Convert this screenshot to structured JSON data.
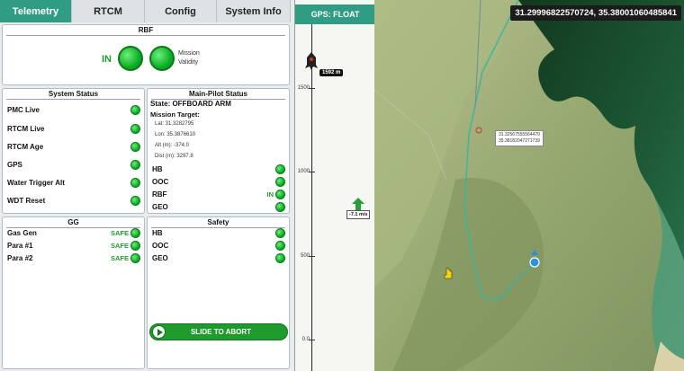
{
  "tabs": [
    {
      "label": "Telemetry",
      "active": true
    },
    {
      "label": "RTCM",
      "active": false
    },
    {
      "label": "Config",
      "active": false
    },
    {
      "label": "System Info",
      "active": false
    }
  ],
  "rbf": {
    "title": "RBF",
    "in_label": "IN",
    "mission_label_1": "Mission",
    "mission_label_2": "Validity"
  },
  "system_status": {
    "title": "System Status",
    "items": [
      {
        "label": "PMC Live",
        "state": ""
      },
      {
        "label": "RTCM Live",
        "state": ""
      },
      {
        "label": "RTCM Age",
        "state": ""
      },
      {
        "label": "GPS",
        "state": ""
      },
      {
        "label": "Water Trigger Alt",
        "state": ""
      },
      {
        "label": "WDT Reset",
        "state": ""
      }
    ]
  },
  "main_pilot": {
    "title": "Main-Pilot Status",
    "state": "State: OFFBOARD ARM",
    "mission_target": "Mission Target:",
    "lat": "Lat: 31.3282795",
    "lon": "Lon: 35.3876610",
    "alt": "Alt (m): -374.0",
    "dist": "Dist (m): 3297.8",
    "items": [
      {
        "label": "HB",
        "state": ""
      },
      {
        "label": "OOC",
        "state": ""
      },
      {
        "label": "RBF",
        "state": "IN"
      },
      {
        "label": "GEO",
        "state": ""
      }
    ]
  },
  "gg": {
    "title": "GG",
    "items": [
      {
        "label": "Gas Gen",
        "state": "SAFE"
      },
      {
        "label": "Para #1",
        "state": "SAFE"
      },
      {
        "label": "Para #2",
        "state": "SAFE"
      }
    ]
  },
  "safety": {
    "title": "Safety",
    "items": [
      {
        "label": "HB",
        "state": ""
      },
      {
        "label": "OOC",
        "state": ""
      },
      {
        "label": "GEO",
        "state": ""
      }
    ]
  },
  "abort": {
    "label": "SLIDE TO ABORT"
  },
  "altitude": {
    "gps_status": "GPS: FLOAT",
    "current_alt": "1592 m",
    "vertical_speed": "-7.1 m/s",
    "ticks": [
      "1500",
      "1000",
      "500",
      "0.0"
    ]
  },
  "map": {
    "coords": "31.29996822570724, 35.38001060485841",
    "tooltip_1": "31.32567555564470",
    "tooltip_2": "35.38182047271739"
  },
  "colors": {
    "accent": "#2f9c83",
    "ok": "#1f9a2d"
  }
}
